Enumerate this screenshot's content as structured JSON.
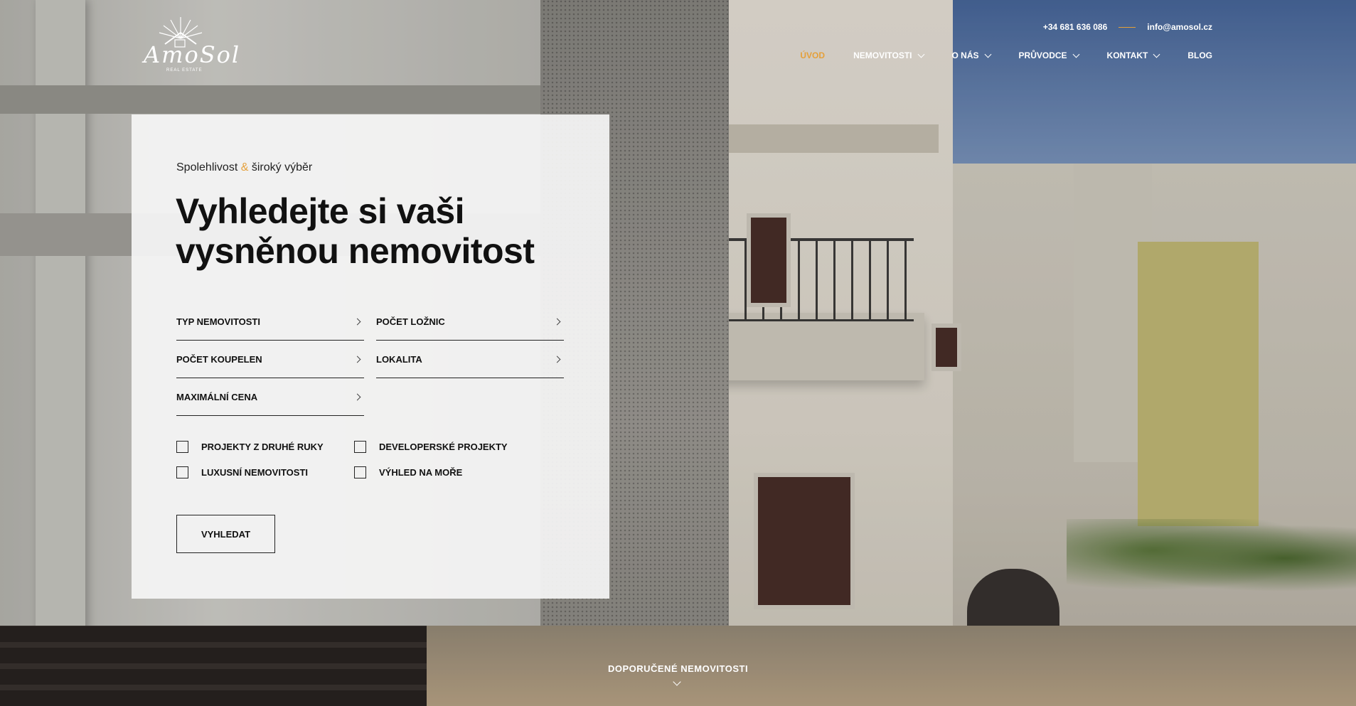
{
  "brand": {
    "logo_text": "AmoSol",
    "logo_sub": "REAL ESTATE"
  },
  "topbar": {
    "phone": "+34 681 636 086",
    "email": "info@amosol.cz"
  },
  "nav": [
    {
      "label": "ÚVOD",
      "active": true,
      "dropdown": false
    },
    {
      "label": "NEMOVITOSTI",
      "active": false,
      "dropdown": true
    },
    {
      "label": "O NÁS",
      "active": false,
      "dropdown": true
    },
    {
      "label": "PRŮVODCE",
      "active": false,
      "dropdown": true
    },
    {
      "label": "KONTAKT",
      "active": false,
      "dropdown": true
    },
    {
      "label": "BLOG",
      "active": false,
      "dropdown": false
    }
  ],
  "hero": {
    "tagline_before": "Spolehlivost",
    "tagline_amp": "&",
    "tagline_after": "široký výběr",
    "headline": "Vyhledejte si vaši vysněnou nemovitost"
  },
  "search": {
    "fields": [
      {
        "label": "TYP NEMOVITOSTI"
      },
      {
        "label": "POČET LOŽNIC"
      },
      {
        "label": "POČET KOUPELEN"
      },
      {
        "label": "LOKALITA"
      },
      {
        "label": "MAXIMÁLNÍ CENA"
      }
    ],
    "checkboxes": [
      {
        "label": "PROJEKTY Z DRUHÉ RUKY",
        "checked": false
      },
      {
        "label": "DEVELOPERSKÉ PROJEKTY",
        "checked": false
      },
      {
        "label": "LUXUSNÍ NEMOVITOSTI",
        "checked": false
      },
      {
        "label": "VÝHLED NA MOŘE",
        "checked": false
      }
    ],
    "submit_label": "VYHLEDAT"
  },
  "featured": {
    "label": "DOPORUČENÉ NEMOVITOSTI"
  },
  "colors": {
    "accent": "#e5a03a",
    "text": "#111111",
    "card_bg": "#f5f5f5"
  }
}
